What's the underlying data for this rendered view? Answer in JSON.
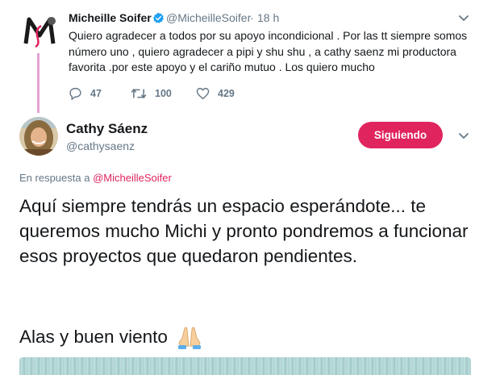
{
  "parent_tweet": {
    "author_name": "Micheille Soifer",
    "handle": "@MicheilleSoifer",
    "separator": "·",
    "time": "18 h",
    "text": "Quiero agradecer a todos por su apoyo incondicional . Por las tt siempre somos número uno , quiero agradecer a pipi y shu shu , a cathy saenz mi productora favorita .por este apoyo y el cariño mutuo . Los quiero mucho",
    "actions": {
      "replies": "47",
      "retweets": "100",
      "likes": "429"
    },
    "avatar_logo_text": "M"
  },
  "reply_tweet": {
    "author_name": "Cathy Sáenz",
    "handle": "@cathysaenz",
    "follow_button_label": "Siguiendo",
    "reply_prefix": "En respuesta a",
    "reply_mention": "@MicheilleSoifer",
    "text": "Aquí siempre tendrás un espacio esperándote... te queremos mucho Michi y pronto pondremos a funcionar esos proyectos que quedaron pendientes.",
    "text2": "Alas y buen viento"
  },
  "icons": {
    "verified": "verified-badge-icon",
    "reply": "reply-icon",
    "retweet": "retweet-icon",
    "like": "heart-icon",
    "more": "chevron-down-icon",
    "emoji": "folded-hands-emoji"
  },
  "colors": {
    "accent": "#e0245e",
    "thread_line": "#e5a3d6",
    "secondary_text": "#657786",
    "verified": "#1da1f2"
  }
}
